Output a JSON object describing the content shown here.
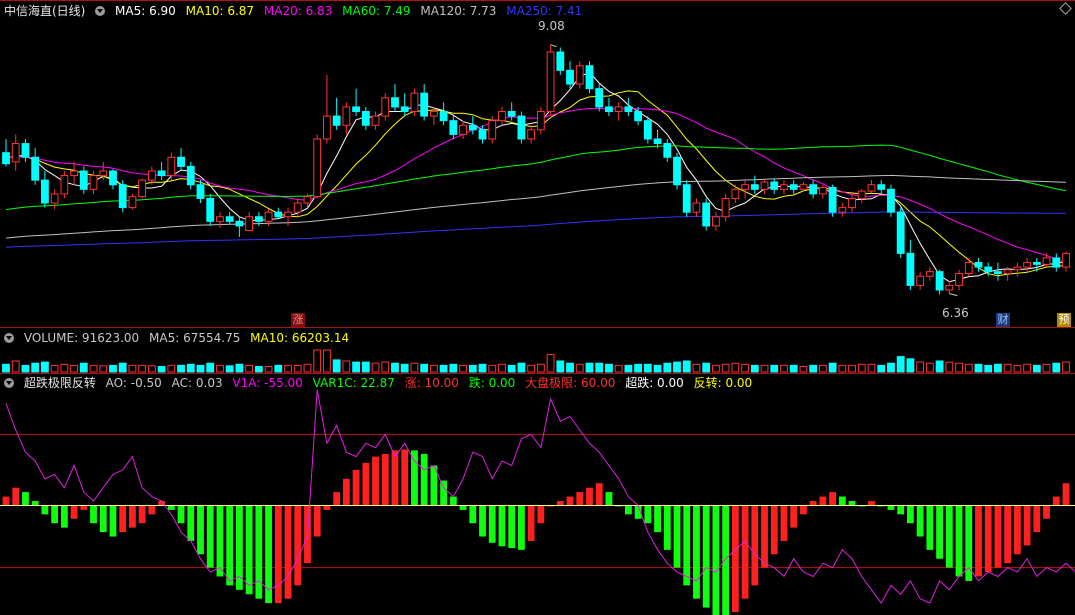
{
  "main_panel": {
    "title": "中信海直(日线)",
    "indicators": [
      {
        "label": "MA5: 6.90",
        "color": "#ffffff"
      },
      {
        "label": "MA10: 6.87",
        "color": "#ffff00"
      },
      {
        "label": "MA20: 6.83",
        "color": "#ff00ff"
      },
      {
        "label": "MA60: 7.49",
        "color": "#00ff00"
      },
      {
        "label": "MA120: 7.73",
        "color": "#c0c0c0"
      },
      {
        "label": "MA250: 7.41",
        "color": "#3333ff"
      }
    ],
    "high_label": "9.08",
    "low_label": "6.36",
    "badge_up": "涨",
    "badge_fin": "财",
    "badge_pre": "预"
  },
  "volume_panel": {
    "indicators": [
      {
        "label": "VOLUME: 91623.00",
        "color": "#c8c8c8"
      },
      {
        "label": "MA5: 67554.75",
        "color": "#c8c8c8"
      },
      {
        "label": "MA10: 66203.14",
        "color": "#ffff00"
      }
    ]
  },
  "osc_panel": {
    "title": "超跌极限反转",
    "indicators": [
      {
        "label": "AO: -0.50",
        "color": "#c8c8c8"
      },
      {
        "label": "AC: 0.03",
        "color": "#c8c8c8"
      },
      {
        "label": "V1A: -55.00",
        "color": "#ff00ff"
      },
      {
        "label": "VAR1C: 22.87",
        "color": "#00ff00"
      },
      {
        "label": "涨: 10.00",
        "color": "#ff3030"
      },
      {
        "label": "跌: 0.00",
        "color": "#00ff00"
      },
      {
        "label": "大盘极限: 60.00",
        "color": "#ff3030"
      },
      {
        "label": "超跌: 0.00",
        "color": "#ffffff"
      },
      {
        "label": "反转: 0.00",
        "color": "#ffff00"
      }
    ]
  },
  "chart_data": {
    "type": "candlestick",
    "price_range": [
      6.05,
      9.35
    ],
    "up_color": "#ff3232",
    "down_color": "#00ffff",
    "candles": [
      [
        7.9,
        8.05,
        7.75,
        7.78
      ],
      [
        7.8,
        8.1,
        7.7,
        8.0
      ],
      [
        8.0,
        8.05,
        7.8,
        7.85
      ],
      [
        7.85,
        7.95,
        7.55,
        7.6
      ],
      [
        7.6,
        7.7,
        7.3,
        7.35
      ],
      [
        7.35,
        7.5,
        7.28,
        7.45
      ],
      [
        7.45,
        7.7,
        7.4,
        7.65
      ],
      [
        7.65,
        7.8,
        7.55,
        7.7
      ],
      [
        7.7,
        7.75,
        7.45,
        7.5
      ],
      [
        7.5,
        7.7,
        7.45,
        7.65
      ],
      [
        7.65,
        7.8,
        7.6,
        7.7
      ],
      [
        7.7,
        7.72,
        7.5,
        7.55
      ],
      [
        7.55,
        7.6,
        7.25,
        7.3
      ],
      [
        7.3,
        7.45,
        7.28,
        7.42
      ],
      [
        7.42,
        7.62,
        7.4,
        7.6
      ],
      [
        7.6,
        7.75,
        7.55,
        7.7
      ],
      [
        7.7,
        7.8,
        7.6,
        7.65
      ],
      [
        7.65,
        7.9,
        7.6,
        7.85
      ],
      [
        7.85,
        7.95,
        7.7,
        7.75
      ],
      [
        7.75,
        7.8,
        7.5,
        7.55
      ],
      [
        7.55,
        7.6,
        7.35,
        7.4
      ],
      [
        7.4,
        7.45,
        7.1,
        7.15
      ],
      [
        7.15,
        7.25,
        7.08,
        7.2
      ],
      [
        7.2,
        7.25,
        7.12,
        7.15
      ],
      [
        7.15,
        7.2,
        6.98,
        7.1
      ],
      [
        7.05,
        7.25,
        7.05,
        7.2
      ],
      [
        7.2,
        7.25,
        7.1,
        7.15
      ],
      [
        7.15,
        7.28,
        7.1,
        7.25
      ],
      [
        7.25,
        7.3,
        7.18,
        7.2
      ],
      [
        7.2,
        7.3,
        7.1,
        7.25
      ],
      [
        7.25,
        7.4,
        7.2,
        7.35
      ],
      [
        7.35,
        7.45,
        7.3,
        7.42
      ],
      [
        7.42,
        8.1,
        7.4,
        8.05
      ],
      [
        8.05,
        8.75,
        8.0,
        8.3
      ],
      [
        8.3,
        8.5,
        8.15,
        8.2
      ],
      [
        8.2,
        8.45,
        8.1,
        8.4
      ],
      [
        8.4,
        8.6,
        8.3,
        8.35
      ],
      [
        8.35,
        8.4,
        8.15,
        8.2
      ],
      [
        8.2,
        8.35,
        8.15,
        8.3
      ],
      [
        8.3,
        8.55,
        8.25,
        8.5
      ],
      [
        8.5,
        8.65,
        8.35,
        8.4
      ],
      [
        8.4,
        8.55,
        8.3,
        8.35
      ],
      [
        8.35,
        8.6,
        8.3,
        8.55
      ],
      [
        8.55,
        8.65,
        8.25,
        8.3
      ],
      [
        8.3,
        8.4,
        8.2,
        8.35
      ],
      [
        8.35,
        8.45,
        8.2,
        8.25
      ],
      [
        8.25,
        8.3,
        8.05,
        8.1
      ],
      [
        8.1,
        8.25,
        8.05,
        8.2
      ],
      [
        8.2,
        8.3,
        8.1,
        8.15
      ],
      [
        8.15,
        8.2,
        8.0,
        8.05
      ],
      [
        8.05,
        8.3,
        8.0,
        8.25
      ],
      [
        8.25,
        8.4,
        8.2,
        8.35
      ],
      [
        8.35,
        8.45,
        8.25,
        8.3
      ],
      [
        8.3,
        8.35,
        8.0,
        8.05
      ],
      [
        8.05,
        8.2,
        8.0,
        8.15
      ],
      [
        8.15,
        8.4,
        8.1,
        8.35
      ],
      [
        8.35,
        9.08,
        8.3,
        9.0
      ],
      [
        9.0,
        9.05,
        8.75,
        8.8
      ],
      [
        8.8,
        8.9,
        8.6,
        8.65
      ],
      [
        8.65,
        8.9,
        8.6,
        8.85
      ],
      [
        8.85,
        8.9,
        8.55,
        8.6
      ],
      [
        8.6,
        8.65,
        8.35,
        8.4
      ],
      [
        8.4,
        8.5,
        8.3,
        8.35
      ],
      [
        8.35,
        8.45,
        8.25,
        8.4
      ],
      [
        8.4,
        8.5,
        8.3,
        8.35
      ],
      [
        8.35,
        8.4,
        8.2,
        8.25
      ],
      [
        8.25,
        8.3,
        8.0,
        8.05
      ],
      [
        8.05,
        8.15,
        7.95,
        8.0
      ],
      [
        8.0,
        8.05,
        7.8,
        7.85
      ],
      [
        7.85,
        7.9,
        7.5,
        7.55
      ],
      [
        7.55,
        7.6,
        7.2,
        7.25
      ],
      [
        7.25,
        7.4,
        7.2,
        7.35
      ],
      [
        7.35,
        7.4,
        7.05,
        7.1
      ],
      [
        7.1,
        7.25,
        7.05,
        7.2
      ],
      [
        7.2,
        7.45,
        7.15,
        7.4
      ],
      [
        7.4,
        7.55,
        7.35,
        7.5
      ],
      [
        7.5,
        7.6,
        7.4,
        7.55
      ],
      [
        7.55,
        7.65,
        7.45,
        7.5
      ],
      [
        7.5,
        7.6,
        7.45,
        7.58
      ],
      [
        7.58,
        7.62,
        7.45,
        7.5
      ],
      [
        7.5,
        7.6,
        7.45,
        7.55
      ],
      [
        7.55,
        7.6,
        7.45,
        7.5
      ],
      [
        7.5,
        7.58,
        7.48,
        7.55
      ],
      [
        7.55,
        7.6,
        7.4,
        7.45
      ],
      [
        7.45,
        7.55,
        7.4,
        7.52
      ],
      [
        7.52,
        7.55,
        7.2,
        7.25
      ],
      [
        7.25,
        7.35,
        7.2,
        7.3
      ],
      [
        7.3,
        7.45,
        7.25,
        7.4
      ],
      [
        7.4,
        7.5,
        7.35,
        7.48
      ],
      [
        7.48,
        7.6,
        7.45,
        7.55
      ],
      [
        7.55,
        7.6,
        7.45,
        7.5
      ],
      [
        7.5,
        7.55,
        7.2,
        7.25
      ],
      [
        7.25,
        7.3,
        6.75,
        6.8
      ],
      [
        6.8,
        6.95,
        6.4,
        6.45
      ],
      [
        6.45,
        6.6,
        6.4,
        6.55
      ],
      [
        6.55,
        6.65,
        6.5,
        6.6
      ],
      [
        6.6,
        6.62,
        6.35,
        6.4
      ],
      [
        6.4,
        6.5,
        6.36,
        6.45
      ],
      [
        6.45,
        6.62,
        6.4,
        6.58
      ],
      [
        6.58,
        6.75,
        6.55,
        6.7
      ],
      [
        6.7,
        6.75,
        6.6,
        6.65
      ],
      [
        6.65,
        6.7,
        6.55,
        6.6
      ],
      [
        6.6,
        6.7,
        6.5,
        6.58
      ],
      [
        6.58,
        6.65,
        6.5,
        6.62
      ],
      [
        6.62,
        6.7,
        6.55,
        6.65
      ],
      [
        6.65,
        6.75,
        6.6,
        6.7
      ],
      [
        6.7,
        6.75,
        6.6,
        6.68
      ],
      [
        6.68,
        6.8,
        6.65,
        6.75
      ],
      [
        6.75,
        6.8,
        6.6,
        6.65
      ],
      [
        6.65,
        6.82,
        6.6,
        6.8
      ]
    ],
    "volume": [
      0.35,
      0.5,
      0.3,
      0.4,
      0.45,
      0.3,
      0.35,
      0.3,
      0.4,
      0.3,
      0.28,
      0.3,
      0.4,
      0.3,
      0.3,
      0.28,
      0.25,
      0.3,
      0.3,
      0.35,
      0.3,
      0.4,
      0.3,
      0.28,
      0.35,
      0.3,
      0.25,
      0.25,
      0.3,
      0.3,
      0.3,
      0.35,
      1.0,
      1.0,
      0.55,
      0.5,
      0.45,
      0.45,
      0.4,
      0.45,
      0.4,
      0.35,
      0.4,
      0.35,
      0.3,
      0.3,
      0.35,
      0.3,
      0.3,
      0.35,
      0.3,
      0.35,
      0.3,
      0.4,
      0.3,
      0.35,
      0.8,
      0.5,
      0.4,
      0.35,
      0.4,
      0.4,
      0.35,
      0.3,
      0.3,
      0.35,
      0.35,
      0.3,
      0.4,
      0.45,
      0.5,
      0.35,
      0.4,
      0.3,
      0.35,
      0.4,
      0.35,
      0.3,
      0.3,
      0.3,
      0.3,
      0.3,
      0.25,
      0.3,
      0.3,
      0.4,
      0.3,
      0.3,
      0.35,
      0.35,
      0.3,
      0.4,
      0.7,
      0.6,
      0.45,
      0.4,
      0.5,
      0.45,
      0.4,
      0.35,
      0.35,
      0.3,
      0.35,
      0.35,
      0.3,
      0.35,
      0.3,
      0.35,
      0.4,
      0.45
    ],
    "osc_range": [
      -120,
      130
    ],
    "osc_hist": [
      10,
      20,
      15,
      5,
      -10,
      -20,
      -25,
      -15,
      -5,
      -20,
      -30,
      -35,
      -30,
      -25,
      -20,
      -10,
      5,
      -5,
      -20,
      -40,
      -55,
      -70,
      -80,
      -90,
      -95,
      -100,
      -105,
      -110,
      -110,
      -105,
      -90,
      -65,
      -35,
      -5,
      15,
      30,
      40,
      48,
      55,
      58,
      62,
      63,
      62,
      58,
      45,
      28,
      10,
      -5,
      -20,
      -35,
      -42,
      -46,
      -48,
      -50,
      -40,
      -20,
      0,
      5,
      10,
      15,
      20,
      25,
      15,
      0,
      -10,
      -15,
      -20,
      -30,
      -50,
      -70,
      -90,
      -105,
      -115,
      -125,
      -128,
      -120,
      -105,
      -90,
      -70,
      -55,
      -40,
      -25,
      -10,
      5,
      10,
      15,
      10,
      5,
      0,
      5,
      0,
      -5,
      -10,
      -20,
      -35,
      -50,
      -60,
      -70,
      -80,
      -85,
      -80,
      -75,
      -70,
      -65,
      -55,
      -45,
      -30,
      -15,
      10,
      25
    ],
    "osc_line": [
      115,
      85,
      60,
      50,
      30,
      35,
      20,
      45,
      15,
      5,
      20,
      35,
      40,
      55,
      20,
      10,
      5,
      -10,
      -30,
      -40,
      -60,
      -75,
      -70,
      -85,
      -80,
      -90,
      -85,
      -95,
      -90,
      -80,
      -60,
      -35,
      130,
      70,
      90,
      60,
      55,
      70,
      65,
      80,
      55,
      70,
      50,
      40,
      45,
      20,
      10,
      30,
      60,
      55,
      30,
      50,
      45,
      75,
      80,
      65,
      120,
      95,
      100,
      85,
      70,
      60,
      45,
      30,
      10,
      0,
      -30,
      -50,
      -65,
      -75,
      -80,
      -85,
      -70,
      -75,
      -60,
      -50,
      -40,
      -55,
      -65,
      -70,
      -80,
      -60,
      -75,
      -80,
      -65,
      -70,
      -50,
      -60,
      -80,
      -95,
      -110,
      -90,
      -100,
      -85,
      -105,
      -110,
      -85,
      -95,
      -80,
      -70,
      -85,
      -75,
      -80,
      -70,
      -75,
      -60,
      -80,
      -70,
      -75,
      -65,
      -75,
      -70
    ],
    "osc_levels": {
      "upper": 80,
      "zero": 0,
      "lower": -70
    }
  }
}
